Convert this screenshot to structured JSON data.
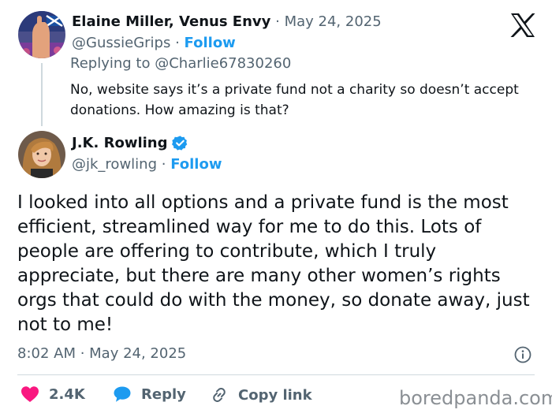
{
  "reply_tweet": {
    "display_name": "Elaine Miller, Venus Envy",
    "date": "May 24, 2025",
    "handle": "@GussieGrips",
    "follow_label": "Follow",
    "replying_to_prefix": "Replying to",
    "replying_to_handle": "@Charlie67830260",
    "text": "No, website says it’s a private fund not a charity so doesn’t accept donations.  How amazing is that?"
  },
  "main_tweet": {
    "display_name": "J.K. Rowling",
    "handle": "@jk_rowling",
    "follow_label": "Follow",
    "text": "I looked into all options and a private fund is the most efficient, streamlined way for me to do this. Lots of people are offering to contribute, which I truly appreciate, but there are many other women’s rights orgs that could do with the money, so donate away, just not to me!",
    "timestamp": "8:02 AM · May 24, 2025"
  },
  "actions": {
    "like_count": "2.4K",
    "reply_label": "Reply",
    "copy_link_label": "Copy link"
  },
  "separator": "·",
  "watermark": "boredpanda.com",
  "colors": {
    "link_blue": "#1d9bf0",
    "like_pink": "#f91880",
    "muted_gray": "#536471",
    "text_dark": "#0f1419"
  }
}
